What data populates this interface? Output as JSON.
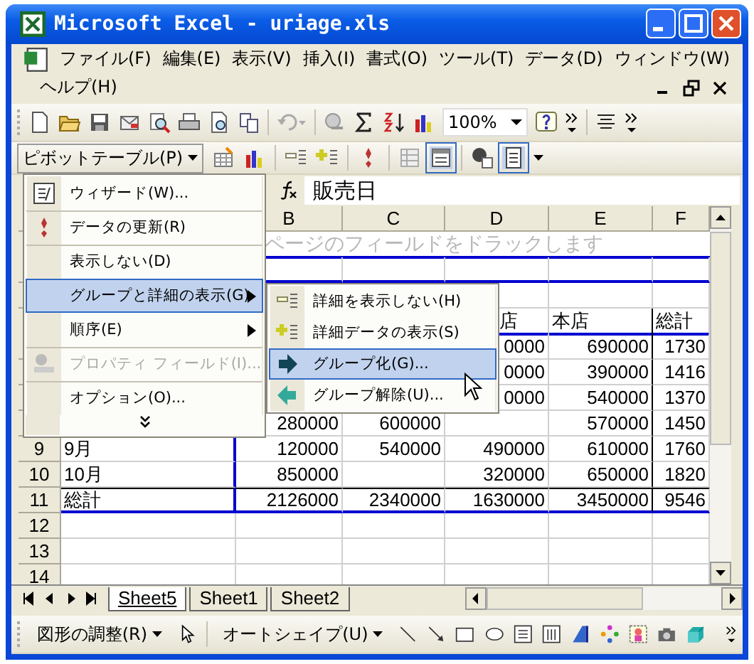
{
  "window": {
    "title": "Microsoft Excel - uriage.xls"
  },
  "menu_bar": {
    "items": [
      "ファイル(F)",
      "編集(E)",
      "表示(V)",
      "挿入(I)",
      "書式(O)",
      "ツール(T)",
      "データ(D)",
      "ウィンドウ(W)",
      "ヘルプ(H)"
    ]
  },
  "standard_toolbar": {
    "zoom": "100%"
  },
  "pivot_toolbar": {
    "menu_button": "ピボットテーブル(P)"
  },
  "formula_bar": {
    "value": "販売日"
  },
  "sheet": {
    "columns": [
      "B",
      "C",
      "D",
      "E",
      "F"
    ],
    "rows": [
      {
        "kind": "page_field",
        "text": "ページのフィールドをドラックします"
      },
      {
        "kind": "filter"
      },
      {
        "kind": "blank"
      },
      {
        "kind": "header",
        "cells": [
          null,
          null,
          null,
          "店",
          "本店",
          "総計"
        ]
      },
      {
        "kind": "data",
        "cells": [
          null,
          null,
          null,
          "0000",
          "690000",
          "1730"
        ]
      },
      {
        "kind": "data",
        "cells": [
          null,
          null,
          null,
          "0000",
          "390000",
          "1416"
        ]
      },
      {
        "kind": "data",
        "cells": [
          null,
          null,
          null,
          "0000",
          "540000",
          "1370"
        ]
      },
      {
        "kind": "data",
        "cells": [
          null,
          "280000",
          "600000",
          null,
          "570000",
          "1450"
        ]
      },
      {
        "kind": "data",
        "number": "9",
        "cells": [
          "9月",
          "120000",
          "540000",
          "490000",
          "610000",
          "1760"
        ]
      },
      {
        "kind": "data",
        "number": "10",
        "cells": [
          "10月",
          "850000",
          null,
          "320000",
          "650000",
          "1820"
        ]
      },
      {
        "kind": "total",
        "number": "11",
        "cells": [
          "総計",
          "2126000",
          "2340000",
          "1630000",
          "3450000",
          "9546"
        ]
      },
      {
        "kind": "empty",
        "number": "12"
      },
      {
        "kind": "empty",
        "number": "13"
      },
      {
        "kind": "empty",
        "number": "14"
      }
    ]
  },
  "context_menu": {
    "items": [
      {
        "label": "ウィザード(W)...",
        "separator_before": false,
        "selected": false,
        "disabled": false,
        "submenu": false
      },
      {
        "label": "データの更新(R)",
        "separator_before": true,
        "selected": false,
        "disabled": false,
        "submenu": false
      },
      {
        "label": "表示しない(D)",
        "separator_before": true,
        "selected": false,
        "disabled": false,
        "submenu": false
      },
      {
        "label": "グループと詳細の表示(G)",
        "separator_before": true,
        "selected": true,
        "disabled": false,
        "submenu": true
      },
      {
        "label": "順序(E)",
        "separator_before": false,
        "selected": false,
        "disabled": false,
        "submenu": true
      },
      {
        "label": "プロパティ フィールド(I)...",
        "separator_before": true,
        "selected": false,
        "disabled": true,
        "submenu": false
      },
      {
        "label": "オプション(O)...",
        "separator_before": true,
        "selected": false,
        "disabled": false,
        "submenu": false
      }
    ]
  },
  "submenu": {
    "items": [
      {
        "label": "詳細を表示しない(H)",
        "selected": false
      },
      {
        "label": "詳細データの表示(S)",
        "selected": false
      },
      {
        "label": "グループ化(G)...",
        "selected": true
      },
      {
        "label": "グループ解除(U)...",
        "selected": false
      }
    ]
  },
  "sheet_tabs": [
    {
      "label": "Sheet5",
      "selected": true
    },
    {
      "label": "Sheet1",
      "selected": false
    },
    {
      "label": "Sheet2",
      "selected": false
    }
  ],
  "drawing_toolbar": {
    "buttons": [
      "図形の調整(R)",
      "オートシェイプ(U)"
    ]
  }
}
